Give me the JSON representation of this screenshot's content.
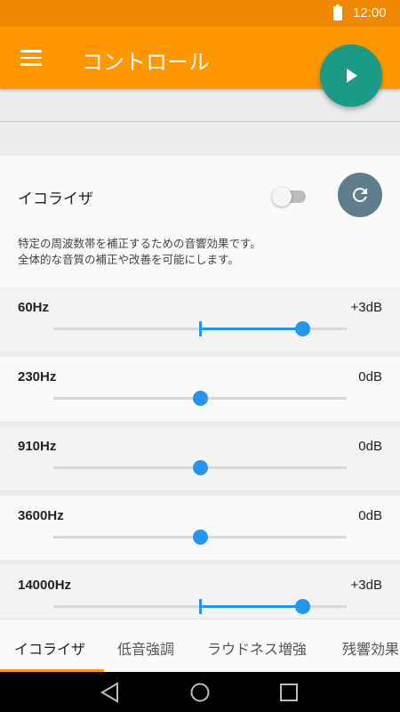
{
  "status_bar": {
    "time": "12:00"
  },
  "app_bar": {
    "title": "コントロール"
  },
  "equalizer": {
    "label": "イコライザ",
    "enabled": false,
    "description": [
      "特定の周波数帯を補正するための音響効果です。",
      "全体的な音質の補正や改善を可能にします。"
    ]
  },
  "bands": [
    {
      "freq": "60Hz",
      "gain": "+3dB",
      "value_db": 3
    },
    {
      "freq": "230Hz",
      "gain": "0dB",
      "value_db": 0
    },
    {
      "freq": "910Hz",
      "gain": "0dB",
      "value_db": 0
    },
    {
      "freq": "3600Hz",
      "gain": "0dB",
      "value_db": 0
    },
    {
      "freq": "14000Hz",
      "gain": "+3dB",
      "value_db": 3
    }
  ],
  "tabs": [
    {
      "label": "イコライザ",
      "selected": true
    },
    {
      "label": "低音強調",
      "selected": false
    },
    {
      "label": "ラウドネス増強",
      "selected": false
    },
    {
      "label": "残響効果",
      "selected": false
    }
  ],
  "colors": {
    "primary": "#ff9800",
    "primary_dark": "#ef8a00",
    "fab": "#1b9a87",
    "accent": "#2196f3",
    "reset_button": "#607d8b"
  }
}
